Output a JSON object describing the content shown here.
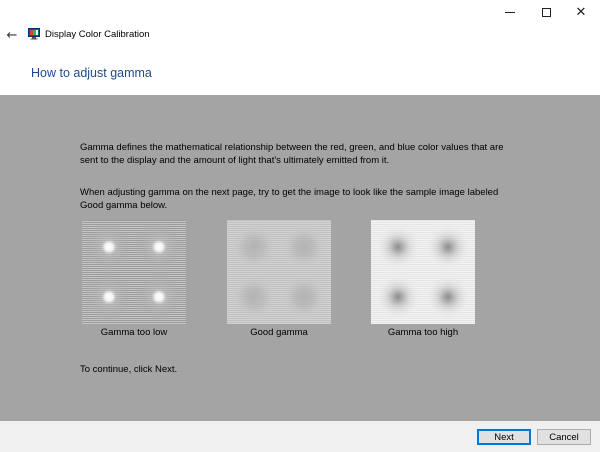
{
  "window": {
    "title": "Display Color Calibration",
    "controls": {
      "minimize": "minimize-icon",
      "maximize": "maximize-icon",
      "close": "close-icon"
    }
  },
  "page": {
    "heading": "How to adjust gamma",
    "paragraph1": "Gamma defines the mathematical relationship between the red, green, and blue color values that are sent to the display and the amount of light that's ultimately emitted from it.",
    "paragraph2": "When adjusting gamma on the next page, try to get the image to look like the sample image labeled Good gamma below.",
    "continue_text": "To continue, click Next.",
    "samples": [
      {
        "label": "Gamma too low"
      },
      {
        "label": "Good gamma"
      },
      {
        "label": "Gamma too high"
      }
    ]
  },
  "footer": {
    "next_label": "Next",
    "cancel_label": "Cancel"
  },
  "colors": {
    "content_bg": "#a4a4a4",
    "heading": "#1f4a86",
    "footer_bg": "#f0f0f0",
    "focus_border": "#0078d7"
  }
}
